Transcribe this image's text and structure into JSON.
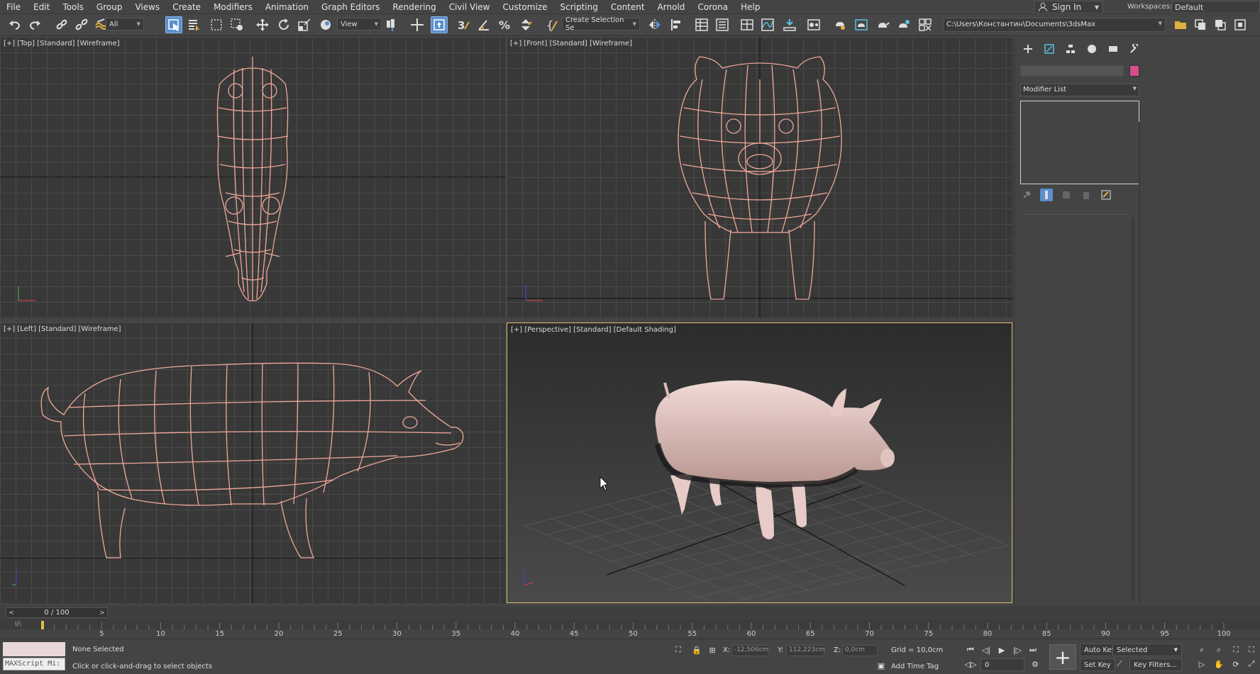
{
  "menu": [
    "File",
    "Edit",
    "Tools",
    "Group",
    "Views",
    "Create",
    "Modifiers",
    "Animation",
    "Graph Editors",
    "Rendering",
    "Civil View",
    "Customize",
    "Scripting",
    "Content",
    "Arnold",
    "Corona",
    "Help"
  ],
  "sign_in": "Sign In",
  "workspaces_label": "Workspaces:",
  "workspace_value": "Default",
  "toolbar": {
    "filter_value": "All",
    "ref_coord_value": "View",
    "selection_set_value": "Create Selection Se",
    "project_path": "C:\\Users\\Константин\\Documents\\3dsMax"
  },
  "viewports": {
    "top": "[+] [Top] [Standard] [Wireframe]",
    "front": "[+] [Front] [Standard] [Wireframe]",
    "left": "[+] [Left] [Standard] [Wireframe]",
    "perspective": "[+] [Perspective] [Standard] [Default Shading]"
  },
  "command_panel": {
    "modifier_list": "Modifier List",
    "object_color": "#d84d8a"
  },
  "timeline": {
    "slider": "0 / 100",
    "ticks": [
      "5",
      "10",
      "15",
      "20",
      "25",
      "30",
      "35",
      "40",
      "45",
      "50",
      "55",
      "60",
      "65",
      "70",
      "75",
      "80",
      "85",
      "90",
      "95",
      "100"
    ]
  },
  "status": {
    "selection": "None Selected",
    "prompt": "Click or click-and-drag to select objects",
    "maxscript": "MAXScript Mi:",
    "x_label": "X:",
    "x_value": "-12,506cm",
    "y_label": "Y:",
    "y_value": "112,223cm",
    "z_label": "Z:",
    "z_value": "0,0cm",
    "grid": "Grid = 10,0cm",
    "add_time_tag": "Add Time Tag",
    "auto_key": "Auto Key",
    "set_key": "Set Key",
    "key_mode": "Selected",
    "key_filters": "Key Filters...",
    "frame": "0"
  },
  "colors": {
    "wire": "#f0a898",
    "active_border": "#e0c060",
    "accent": "#5b8fcf"
  }
}
